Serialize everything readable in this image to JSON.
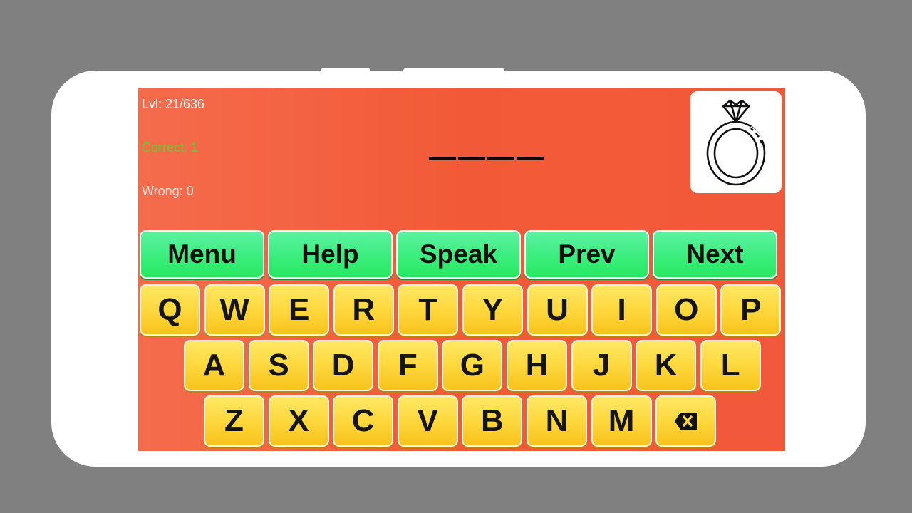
{
  "stats": {
    "level": "Lvl: 21/636",
    "correct": "Correct: 1",
    "wrong": "Wrong: 0"
  },
  "word": {
    "letter_count": 4,
    "blanks": [
      "",
      "",
      "",
      ""
    ]
  },
  "hint_image": {
    "icon": "diamond-ring-icon"
  },
  "actions": [
    {
      "id": "menu",
      "label": "Menu"
    },
    {
      "id": "help",
      "label": "Help"
    },
    {
      "id": "speak",
      "label": "Speak"
    },
    {
      "id": "prev",
      "label": "Prev"
    },
    {
      "id": "next",
      "label": "Next"
    }
  ],
  "keyboard": {
    "row1": [
      "Q",
      "W",
      "E",
      "R",
      "T",
      "Y",
      "U",
      "I",
      "O",
      "P"
    ],
    "row2": [
      "A",
      "S",
      "D",
      "F",
      "G",
      "H",
      "J",
      "K",
      "L"
    ],
    "row3": [
      "Z",
      "X",
      "C",
      "V",
      "B",
      "N",
      "M"
    ],
    "backspace_icon": "backspace-icon"
  },
  "colors": {
    "background": "#808080",
    "screen": "#f25a37",
    "action_button": "#3bee7d",
    "key": "#fdd63a",
    "correct_text": "#5dd22a"
  }
}
